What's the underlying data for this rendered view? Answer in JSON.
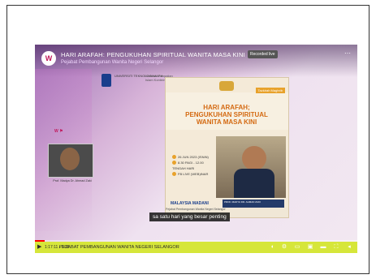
{
  "video": {
    "title": "HARI ARAFAH: PENGUKUHAN SPIRITUAL WANITA MASA KINI",
    "channel": "Pejabat Pembangunan Wanita Negeri Selangor",
    "badge": "Recorded live",
    "caption": "sa satu hari yang besar penting",
    "chapter": "PEJABAT PEMBANGUNAN WANITA NEGERI SELANGOR",
    "time": "1:17:11 / 1:06",
    "progress": 0.03
  },
  "slide": {
    "uni_text": "UNIVERSITI TEKNOLOGI MARA",
    "uni_sub": "Webinar Pengajian Islam Kontemporari",
    "speaker_name": "Prof. Madya Dr. Ahmad Zaki",
    "poster_tag": "Tazkirah Maghrib",
    "poster_title_1": "HARI ARAFAH;",
    "poster_title_2": "PENGUKUHAN SPIRITUAL",
    "poster_title_3": "WANITA MASA KINI",
    "info_1": "26 JUN 2023 (ISNIN)",
    "info_2": "8.30 PAGI - 12.00 TENGAH HARI",
    "info_3": "FB LIVE (WEB)INAR",
    "malaysia": "MALAYSIA MADANI",
    "namecard": "PROF. MADYA DR. AHMAD ZAKI",
    "footer": "Pejabat Pembangunan Wanita Negeri Selangor"
  },
  "icons": {
    "play": "▶",
    "menu": "⋯",
    "settings": "⚙"
  }
}
